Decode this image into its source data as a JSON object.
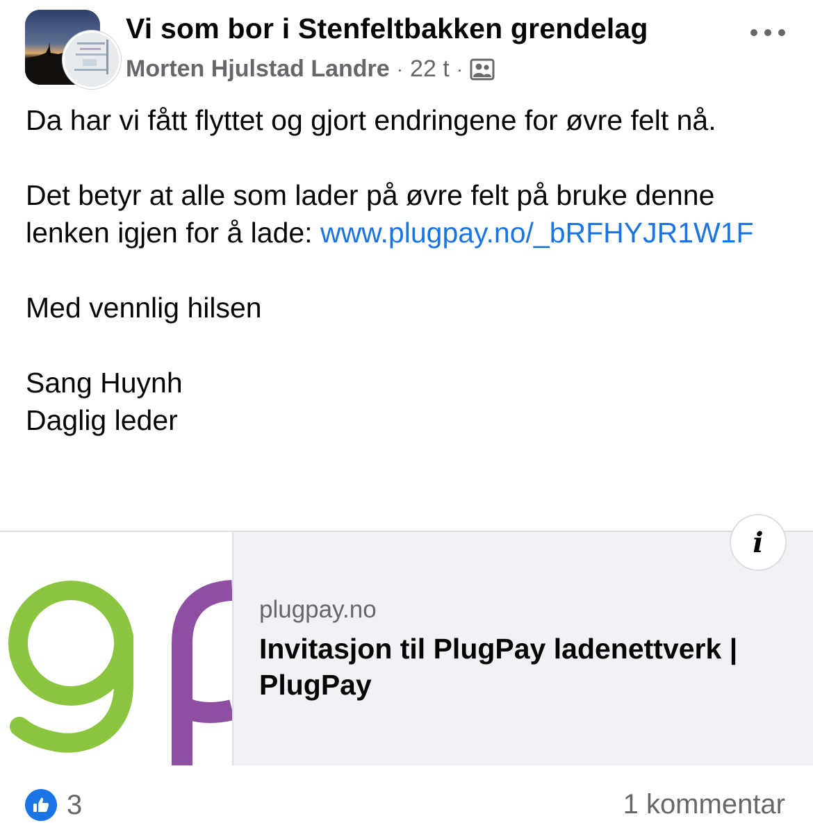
{
  "header": {
    "group_name": "Vi som bor i Stenfeltbakken grendelag",
    "author": "Morten Hjulstad Landre",
    "separator": "·",
    "timestamp": "22 t",
    "audience_icon": "group-members-icon",
    "more_icon": "more-options-icon"
  },
  "post": {
    "line1": "Da har vi fått flyttet og gjort endringene for øvre felt nå.",
    "line2": "Det betyr at alle som lader på øvre felt på bruke denne lenken igjen for å lade: ",
    "link_text": "www.plugpay.no/_bRFHYJR1W1F",
    "greeting": "Med vennlig hilsen",
    "signature_name": "Sang Huynh",
    "signature_title": "Daglig leder"
  },
  "link_preview": {
    "domain": "plugpay.no",
    "title": "Invitasjon til PlugPay ladenettverk | PlugPay",
    "info_label": "i",
    "logo_colors": {
      "g": "#8bc53f",
      "p": "#8e4fa3"
    }
  },
  "footer": {
    "reaction_icon": "like-icon",
    "reaction_count": "3",
    "comments": "1 kommentar"
  },
  "colors": {
    "link": "#1b74e4",
    "secondary_text": "#65676b",
    "preview_bg": "#f0f2f5"
  }
}
